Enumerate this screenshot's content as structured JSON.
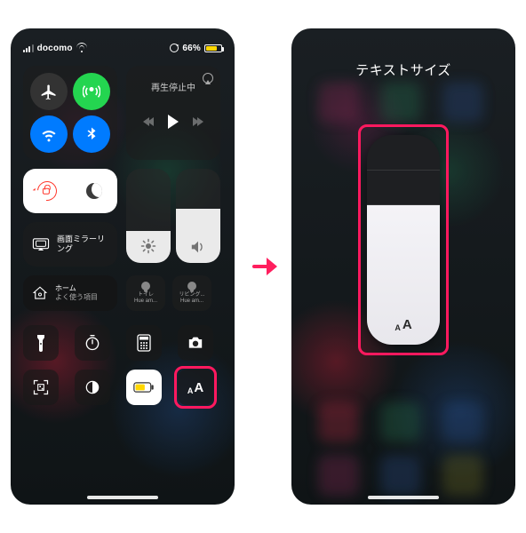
{
  "status": {
    "carrier": "docomo",
    "battery_text": "66%"
  },
  "media": {
    "title": "再生停止中"
  },
  "mirror": {
    "label": "画面ミラーリング"
  },
  "home": {
    "line1": "ホーム",
    "line2": "よく使う項目"
  },
  "accessories": [
    {
      "line1": "トイレ",
      "line2": "Hue am..."
    },
    {
      "line1": "リビング...",
      "line2": "Hue am..."
    }
  ],
  "text_size": {
    "title": "テキストサイズ",
    "level": 4,
    "total": 6
  },
  "icons": {
    "flashlight": "flashlight-icon",
    "timer": "timer-icon",
    "calculator": "calculator-icon",
    "camera": "camera-icon",
    "qr": "qr-icon",
    "darkmode": "darkmode-icon",
    "lowpower": "lowpower-icon",
    "textsize": "textsize-icon"
  }
}
